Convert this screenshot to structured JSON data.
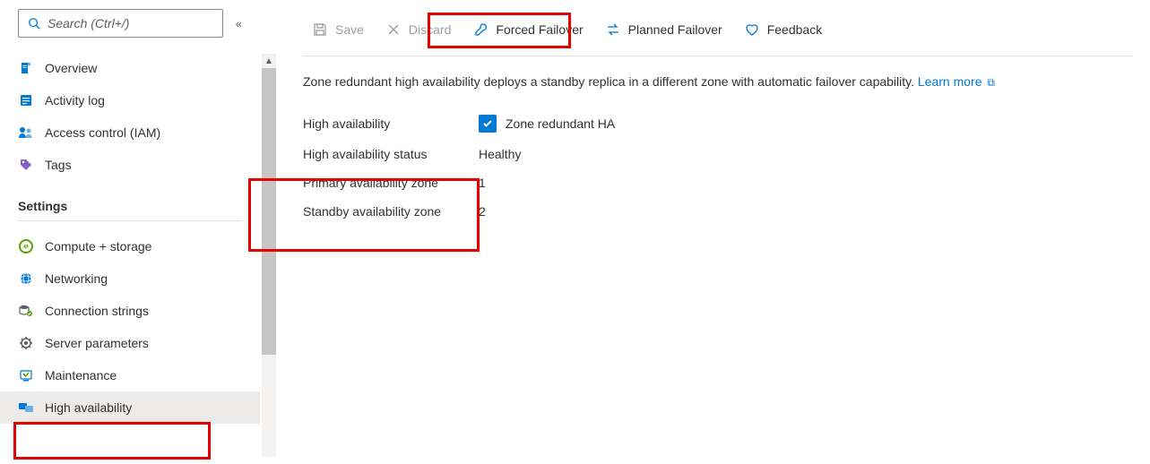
{
  "sidebar": {
    "search_placeholder": "Search (Ctrl+/)",
    "items": [
      {
        "icon": "overview-icon",
        "label": "Overview"
      },
      {
        "icon": "activity-log-icon",
        "label": "Activity log"
      },
      {
        "icon": "access-control-icon",
        "label": "Access control (IAM)"
      },
      {
        "icon": "tags-icon",
        "label": "Tags"
      }
    ],
    "settings_header": "Settings",
    "settings_items": [
      {
        "icon": "compute-storage-icon",
        "label": "Compute + storage"
      },
      {
        "icon": "networking-icon",
        "label": "Networking"
      },
      {
        "icon": "connection-strings-icon",
        "label": "Connection strings"
      },
      {
        "icon": "server-parameters-icon",
        "label": "Server parameters"
      },
      {
        "icon": "maintenance-icon",
        "label": "Maintenance"
      },
      {
        "icon": "high-availability-icon",
        "label": "High availability",
        "selected": true
      }
    ]
  },
  "toolbar": {
    "save_label": "Save",
    "discard_label": "Discard",
    "forced_failover_label": "Forced Failover",
    "planned_failover_label": "Planned Failover",
    "feedback_label": "Feedback"
  },
  "description": {
    "text": "Zone redundant high availability deploys a standby replica in a different zone with automatic failover capability. ",
    "link_label": "Learn more"
  },
  "properties": {
    "ha_label": "High availability",
    "ha_checkbox_label": "Zone redundant HA",
    "ha_status_label": "High availability status",
    "ha_status_value": "Healthy",
    "primary_zone_label": "Primary availability zone",
    "primary_zone_value": "1",
    "standby_zone_label": "Standby availability zone",
    "standby_zone_value": "2"
  }
}
